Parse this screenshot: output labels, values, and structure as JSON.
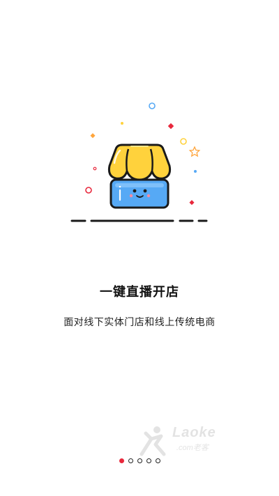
{
  "onboarding": {
    "title": "一键直播开店",
    "subtitle": "面对线下实体门店和线上传统电商"
  },
  "watermark": {
    "brand": "Laoke",
    "sub": ".com老客"
  },
  "pager": {
    "total_pages": 5,
    "active_page": 1
  },
  "colors": {
    "awning_yellow": "#FFD23C",
    "store_blue": "#56A9F5",
    "accent_red": "#E8283C",
    "outline": "#1A1A1A"
  },
  "icons": [
    "store-icon",
    "watermark-logo-icon"
  ]
}
